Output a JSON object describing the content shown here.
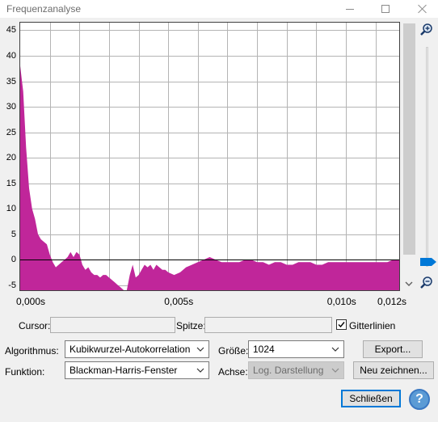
{
  "window": {
    "title": "Frequenzanalyse",
    "minimize_glyph": "—",
    "maximize_glyph": "□",
    "close_glyph": "✕"
  },
  "readouts": {
    "cursor_label": "Cursor:",
    "cursor_value": "",
    "peak_label": "Spitze:",
    "peak_value": "",
    "grid_label": "Gitterlinien",
    "grid_checked": true
  },
  "controls": {
    "algorithm_label": "Algorithmus:",
    "algorithm_value": "Kubikwurzel-Autokorrelation",
    "size_label": "Größe:",
    "size_value": "1024",
    "export_label": "Export...",
    "function_label": "Funktion:",
    "function_value": "Blackman-Harris-Fenster",
    "axis_label": "Achse:",
    "axis_value": "Log. Darstellung",
    "redraw_label": "Neu zeichnen...",
    "close_label": "Schließen",
    "help_glyph": "?"
  },
  "icons": {
    "zoom_in": "zoom-in-icon",
    "zoom_out": "zoom-out-icon",
    "slider_thumb": "slider-thumb-icon",
    "help": "help-icon"
  },
  "colors": {
    "fill": "#c0269a",
    "grid": "#b4b4b4",
    "zero_line": "#000000",
    "accent": "#0078d7"
  },
  "chart_data": {
    "type": "area",
    "title": "",
    "xlabel": "",
    "ylabel": "",
    "xlim": [
      0.0,
      0.0128
    ],
    "ylim": [
      -6,
      46.5
    ],
    "y_ticks": [
      -5,
      0,
      5,
      10,
      15,
      20,
      25,
      30,
      35,
      40,
      45
    ],
    "x_tick_labels": [
      {
        "value": 0.0,
        "label": "0,000s"
      },
      {
        "value": 0.005,
        "label": "0,005s"
      },
      {
        "value": 0.0105,
        "label": "0,010s"
      },
      {
        "value": 0.0122,
        "label": "0,012s"
      }
    ],
    "grid": true,
    "series": [
      {
        "x": [
          0.0,
          0.0001,
          0.0002,
          0.0003,
          0.0004,
          0.0005,
          0.0006,
          0.0007,
          0.0008,
          0.0009,
          0.001,
          0.0011,
          0.0012,
          0.0013,
          0.0014,
          0.0015,
          0.0016,
          0.0017,
          0.0018,
          0.0019,
          0.002,
          0.0021,
          0.0022,
          0.0023,
          0.0024,
          0.0025,
          0.0026,
          0.0027,
          0.0028,
          0.0029,
          0.003,
          0.0031,
          0.0032,
          0.0033,
          0.0034,
          0.0035,
          0.0036,
          0.0037,
          0.0038,
          0.0039,
          0.004,
          0.0041,
          0.0042,
          0.0043,
          0.0044,
          0.0045,
          0.0046,
          0.0047,
          0.0048,
          0.0049,
          0.005,
          0.0052,
          0.0054,
          0.0056,
          0.0058,
          0.006,
          0.0062,
          0.0064,
          0.0066,
          0.0068,
          0.007,
          0.0072,
          0.0074,
          0.0076,
          0.0078,
          0.008,
          0.0082,
          0.0084,
          0.0086,
          0.0088,
          0.009,
          0.0092,
          0.0094,
          0.0096,
          0.0098,
          0.01,
          0.0102,
          0.0104,
          0.0106,
          0.0108,
          0.011,
          0.0112,
          0.0114,
          0.0116,
          0.0118,
          0.012,
          0.0122,
          0.0124,
          0.0126,
          0.0128
        ],
        "y": [
          38,
          33,
          22,
          14,
          10,
          8,
          5,
          4,
          3.5,
          3,
          1,
          -0.5,
          -1.5,
          -1,
          -0.5,
          0,
          0.5,
          1.5,
          0.5,
          1.5,
          1,
          -1,
          -2,
          -1.5,
          -2.5,
          -3,
          -3,
          -3.5,
          -3,
          -3,
          -3.5,
          -4,
          -4.5,
          -5,
          -5.5,
          -6,
          -6,
          -3,
          -1,
          -3.5,
          -3,
          -2,
          -1,
          -1.5,
          -1,
          -2,
          -1,
          -1.5,
          -2,
          -2,
          -2.5,
          -3,
          -2.5,
          -1.5,
          -1,
          -0.5,
          0,
          0.5,
          0,
          -0.5,
          -0.5,
          -0.5,
          -0.5,
          0,
          0,
          -0.5,
          -0.5,
          -1,
          -0.5,
          -0.5,
          -1,
          -1,
          -0.5,
          -0.5,
          -0.5,
          -1,
          -1,
          -0.5,
          -0.5,
          -0.5,
          -0.5,
          -0.5,
          -0.5,
          -0.5,
          -0.5,
          -0.5,
          -0.5,
          -0.5,
          0,
          0
        ]
      }
    ]
  }
}
